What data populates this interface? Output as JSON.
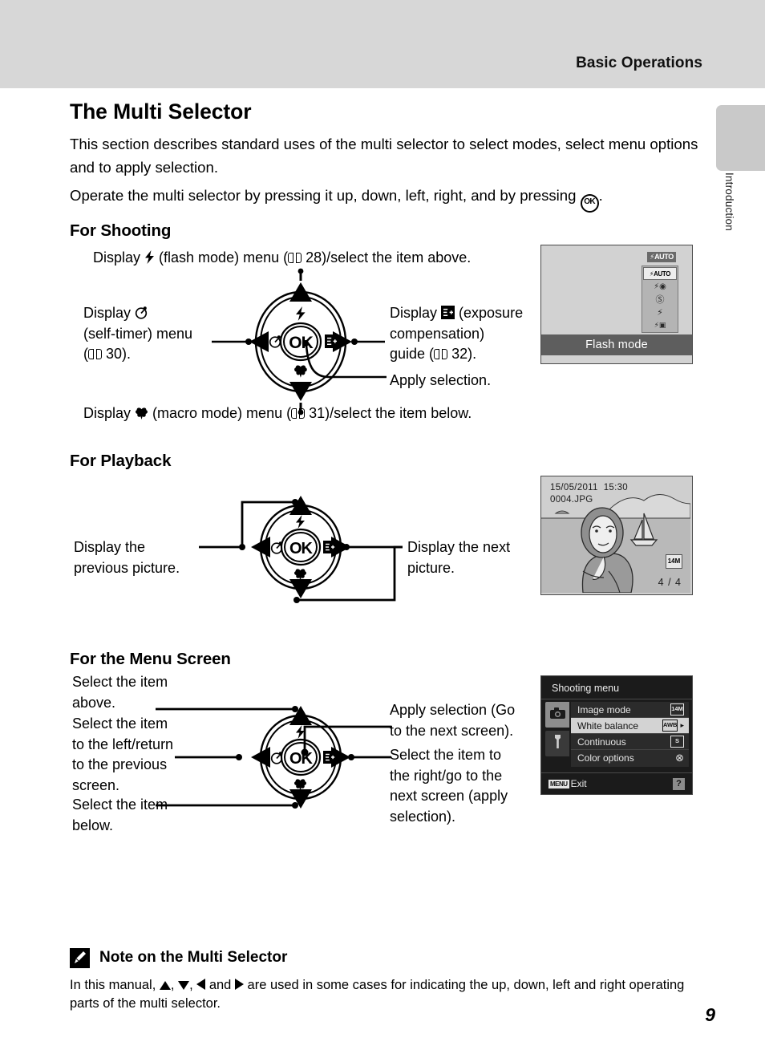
{
  "header": {
    "running_head": "Basic Operations"
  },
  "side_tab": {
    "label": "Introduction"
  },
  "title": "The Multi Selector",
  "intro": {
    "paragraph1": "This section describes standard uses of the multi selector to select modes, select menu options and to apply selection.",
    "paragraph2_before": "Operate the multi selector by pressing it up, down, left, right, and by pressing ",
    "ok_glyph": "OK",
    "paragraph2_after": "."
  },
  "sections": {
    "shooting": {
      "heading": "For Shooting",
      "top_label_before": "Display ",
      "top_label_after": " (flash mode) menu (",
      "top_page": "28",
      "top_label_end": ")/select the item above.",
      "left_line1_before": "Display ",
      "left_line2": "(self-timer) menu",
      "left_line3_page": "30",
      "left_line3": "(  30).",
      "right_line1_before": "Display ",
      "right_line1_after": " (exposure",
      "right_line2": "compensation)",
      "right_line3_before": "guide (",
      "right_page": "32",
      "right_line3_after": ").",
      "apply": "Apply selection.",
      "bottom_before": "Display ",
      "bottom_after": " (macro mode) menu (",
      "bottom_page": "31",
      "bottom_end": ")/select the item below."
    },
    "playback": {
      "heading": "For Playback",
      "left_line1": "Display the",
      "left_line2": "previous picture.",
      "right_line1": "Display the next",
      "right_line2": "picture."
    },
    "menu_screen": {
      "heading": "For the Menu Screen",
      "above_line1": "Select the item",
      "above_line2": "above.",
      "left_line1": "Select the item",
      "left_line2": "to the left/return",
      "left_line3": "to the previous",
      "left_line4": "screen.",
      "below_line1": "Select the item",
      "below_line2": "below.",
      "apply_line1": "Apply selection (Go",
      "apply_line2": "to the next screen).",
      "right_line1": "Select the item to",
      "right_line2": "the right/go to the",
      "right_line3": "next screen (apply",
      "right_line4": "selection)."
    }
  },
  "dial": {
    "ok_label": "OK",
    "flash_icon": "flash-icon",
    "selftimer_icon": "self-timer-icon",
    "exposure_icon": "exposure-compensation-icon",
    "macro_icon": "macro-icon"
  },
  "lcd_flash": {
    "current_mode": "AUTO",
    "caption": "Flash mode",
    "items": [
      {
        "name": "auto-flash",
        "label": "AUTO",
        "selected": true
      },
      {
        "name": "red-eye-reduction",
        "label": "",
        "selected": false
      },
      {
        "name": "flash-off",
        "label": "",
        "selected": false
      },
      {
        "name": "fill-flash",
        "label": "",
        "selected": false
      },
      {
        "name": "slow-sync",
        "label": "",
        "selected": false
      }
    ]
  },
  "lcd_playback": {
    "date": "15/05/2011",
    "time": "15:30",
    "filename": "0004.JPG",
    "frame_counter": "4 / 4",
    "image_size_badge": "14M"
  },
  "lcd_menu": {
    "title": "Shooting menu",
    "tabs": [
      {
        "name": "shooting-tab",
        "icon": "camera-icon",
        "active": true
      },
      {
        "name": "setup-tab",
        "icon": "wrench-icon",
        "active": false
      }
    ],
    "rows": [
      {
        "label": "Image mode",
        "value_badge": "14M",
        "selected": false,
        "arrow": false
      },
      {
        "label": "White balance",
        "value_badge": "AWB",
        "selected": true,
        "arrow": true
      },
      {
        "label": "Continuous",
        "value_badge": "S",
        "selected": false,
        "arrow": false
      },
      {
        "label": "Color options",
        "value_badge": "⊗",
        "selected": false,
        "arrow": false
      }
    ],
    "footer": {
      "menu_key": "MENU",
      "exit_label": "Exit",
      "help_label": "?"
    }
  },
  "note": {
    "icon": "pencil-icon",
    "title": "Note on the Multi Selector",
    "body_before": "In this manual, ",
    "body_mid1": ", ",
    "body_mid2": ", ",
    "body_mid3": " and ",
    "body_after": " are used in some cases for indicating the up, down, left and right operating parts of the multi selector."
  },
  "page_number": "9"
}
